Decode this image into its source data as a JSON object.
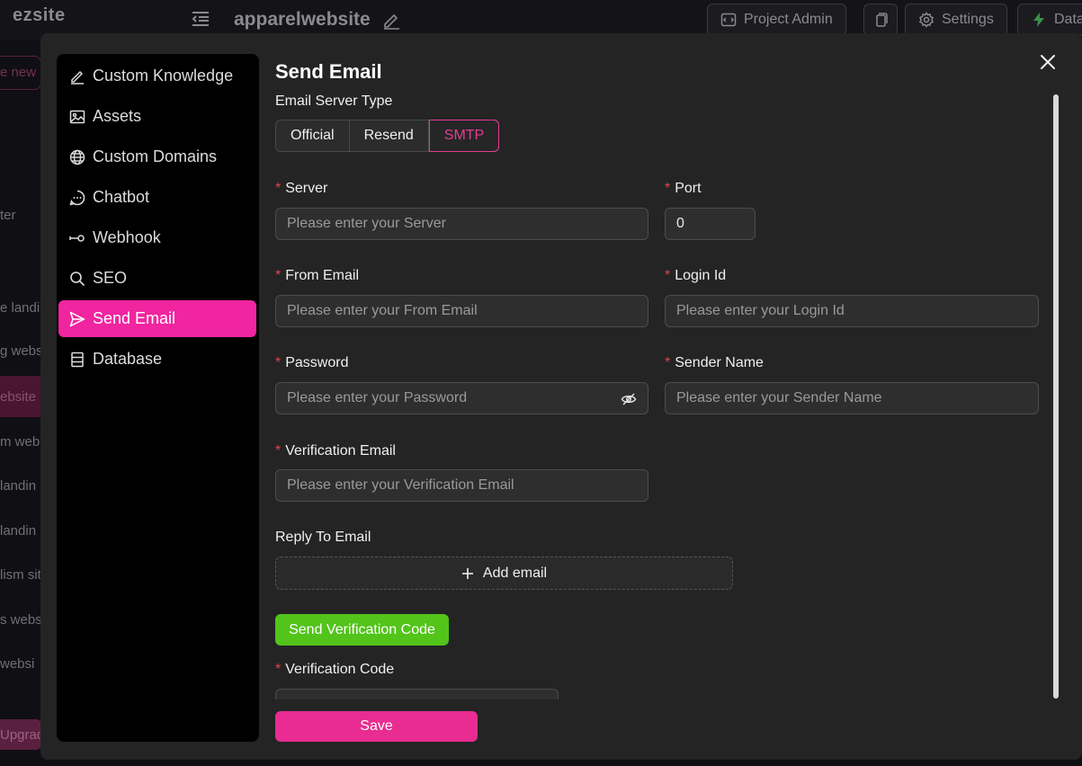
{
  "background": {
    "logo": "ezsite",
    "project_title": "apparelwebsite",
    "buttons": [
      {
        "label": "Project Admin",
        "icon": "code-window-icon"
      },
      {
        "label": "",
        "icon": "copy-icon"
      },
      {
        "label": "Settings",
        "icon": "gear-icon"
      },
      {
        "label": "Data",
        "icon": "lightning-icon"
      }
    ],
    "sidebar_fragments": [
      "e new",
      "ter",
      "e landi",
      "g websi",
      "ebsite",
      "m web",
      " landin",
      " landin",
      "lism sit",
      "s webs",
      " websi",
      "Upgrad"
    ]
  },
  "modal": {
    "nav": [
      {
        "label": "Custom Knowledge",
        "icon": "pencil-icon"
      },
      {
        "label": "Assets",
        "icon": "image-icon"
      },
      {
        "label": "Custom Domains",
        "icon": "globe-icon"
      },
      {
        "label": "Chatbot",
        "icon": "chat-bubble-icon"
      },
      {
        "label": "Webhook",
        "icon": "webhook-icon"
      },
      {
        "label": "SEO",
        "icon": "search-icon"
      },
      {
        "label": "Send Email",
        "icon": "send-icon",
        "active": true
      },
      {
        "label": "Database",
        "icon": "database-icon"
      }
    ],
    "title": "Send Email",
    "server_type": {
      "label": "Email Server Type",
      "options": [
        "Official",
        "Resend",
        "SMTP"
      ],
      "selected": "SMTP"
    },
    "fields": {
      "server": {
        "label": "Server",
        "placeholder": "Please enter your Server"
      },
      "port": {
        "label": "Port",
        "value": "0"
      },
      "from_email": {
        "label": "From Email",
        "placeholder": "Please enter your From Email"
      },
      "login_id": {
        "label": "Login Id",
        "placeholder": "Please enter your Login Id"
      },
      "password": {
        "label": "Password",
        "placeholder": "Please enter your Password"
      },
      "sender_name": {
        "label": "Sender Name",
        "placeholder": "Please enter your Sender Name"
      },
      "verification_email": {
        "label": "Verification Email",
        "placeholder": "Please enter your Verification Email"
      },
      "verification_code": {
        "label": "Verification Code"
      }
    },
    "reply_to": {
      "label": "Reply To Email",
      "add_label": "Add email"
    },
    "send_code_label": "Send Verification Code",
    "save_label": "Save",
    "colors": {
      "accent": "#f0259f",
      "success": "#52c41a",
      "required": "#e0444e"
    }
  }
}
